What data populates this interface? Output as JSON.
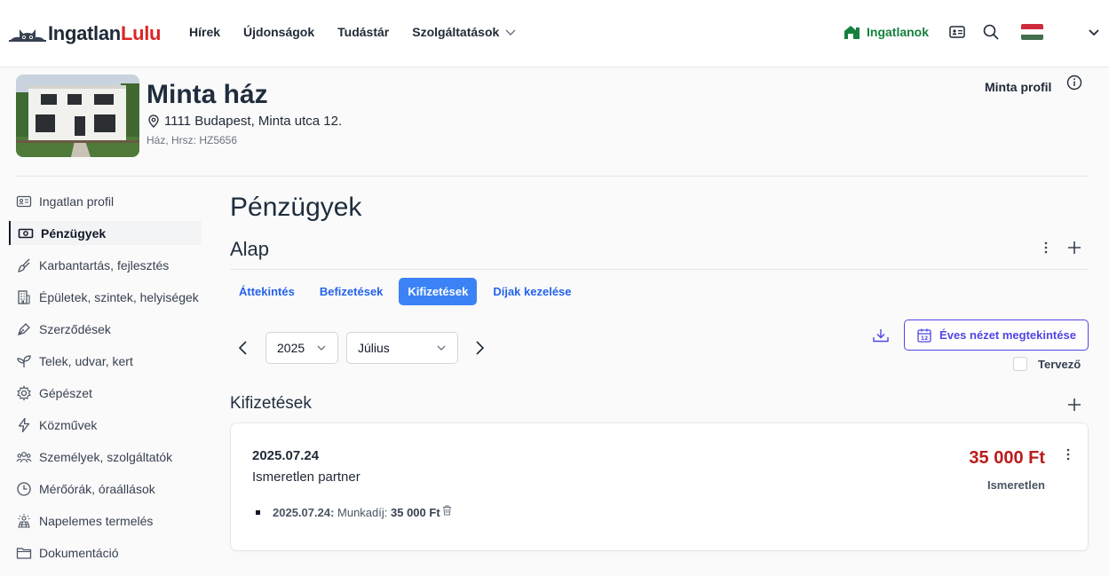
{
  "header": {
    "logo_part1": "Ingatlan",
    "logo_part2": "Lulu",
    "nav": [
      "Hírek",
      "Újdonságok",
      "Tudástár",
      "Szolgáltatások"
    ],
    "properties_label": "Ingatlanok"
  },
  "property": {
    "title": "Minta ház",
    "address": "1111 Budapest, Minta utca 12.",
    "subtitle": "Ház, Hrsz: HZ5656",
    "profile_link": "Minta profil"
  },
  "sidebar": {
    "items": [
      {
        "label": "Ingatlan profil",
        "icon": "id-card-icon"
      },
      {
        "label": "Pénzügyek",
        "icon": "money-icon",
        "active": true
      },
      {
        "label": "Karbantartás, fejlesztés",
        "icon": "brush-icon"
      },
      {
        "label": "Épületek, szintek, helyiségek",
        "icon": "building-icon"
      },
      {
        "label": "Szerződések",
        "icon": "pen-icon"
      },
      {
        "label": "Telek, udvar, kert",
        "icon": "leaf-icon"
      },
      {
        "label": "Gépészet",
        "icon": "gear-icon"
      },
      {
        "label": "Közművek",
        "icon": "bolt-icon"
      },
      {
        "label": "Személyek, szolgáltatók",
        "icon": "people-icon"
      },
      {
        "label": "Mérőórák, óraállások",
        "icon": "clock-icon"
      },
      {
        "label": "Napelemes termelés",
        "icon": "solar-icon"
      },
      {
        "label": "Dokumentáció",
        "icon": "folder-icon"
      }
    ]
  },
  "main": {
    "title": "Pénzügyek",
    "section": "Alap",
    "tabs": [
      {
        "label": "Áttekintés",
        "active": false
      },
      {
        "label": "Befizetések",
        "active": false
      },
      {
        "label": "Kifizetések",
        "active": true
      },
      {
        "label": "Díjak kezelése",
        "active": false
      }
    ],
    "year": "2025",
    "month": "Július",
    "annual_button": "Éves nézet megtekintése",
    "planner_label": "Tervező",
    "list_title": "Kifizetések"
  },
  "payment": {
    "date": "2025.07.24",
    "partner": "Ismeretlen partner",
    "amount": "35 000 Ft",
    "status": "Ismeretlen",
    "item_date": "2025.07.24:",
    "item_desc": " Munkadíj: ",
    "item_amount": "35 000 Ft"
  },
  "colors": {
    "accent": "#3b82f6",
    "brand_red": "#dc2626",
    "green": "#15803d",
    "amount_red": "#b91c1c",
    "indigo": "#4f46e5"
  }
}
